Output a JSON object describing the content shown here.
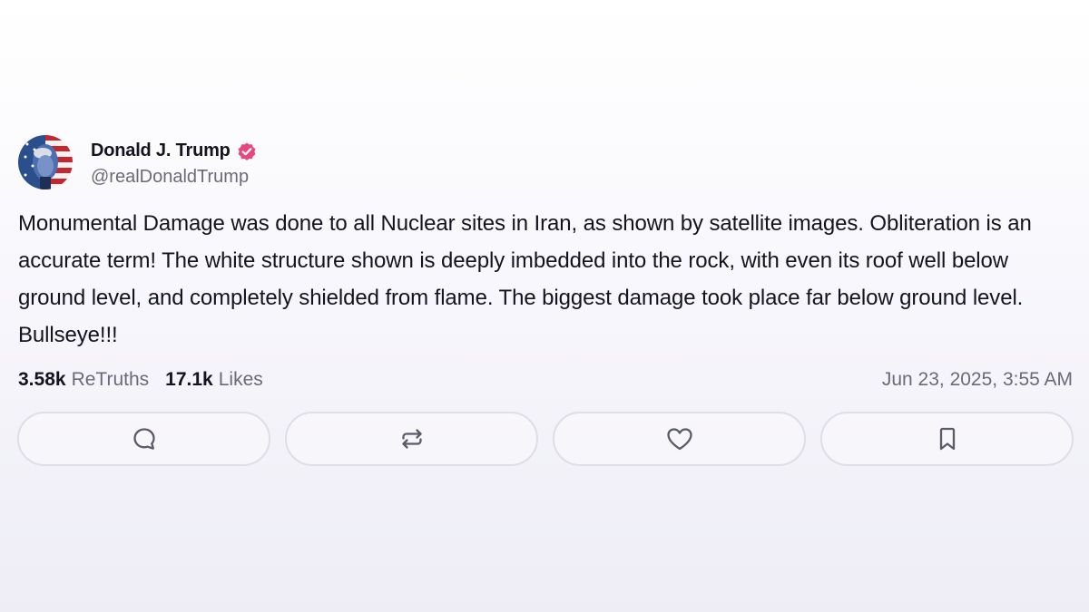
{
  "post": {
    "author": {
      "display_name": "Donald J. Trump",
      "handle": "@realDonaldTrump",
      "verified": true,
      "verified_badge_color": "#e8467c"
    },
    "body": "Monumental Damage was done to all Nuclear sites in Iran, as shown by satellite images. Obliteration is an accurate term! The white structure shown is deeply imbedded into the rock, with even its roof well below ground level, and completely shielded from flame. The biggest damage took place far below ground level. Bullseye!!!",
    "stats": {
      "retruths_count": "3.58k",
      "retruths_label": "ReTruths",
      "likes_count": "17.1k",
      "likes_label": "Likes"
    },
    "timestamp": "Jun 23, 2025, 3:55 AM",
    "actions": [
      {
        "name": "reply",
        "icon": "comment-icon"
      },
      {
        "name": "retruth",
        "icon": "repost-icon"
      },
      {
        "name": "like",
        "icon": "heart-icon"
      },
      {
        "name": "bookmark",
        "icon": "bookmark-icon"
      }
    ]
  },
  "colors": {
    "text_primary": "#141420",
    "text_secondary": "#6a6a78",
    "button_border": "#dedde8",
    "icon": "#5a5a68"
  }
}
